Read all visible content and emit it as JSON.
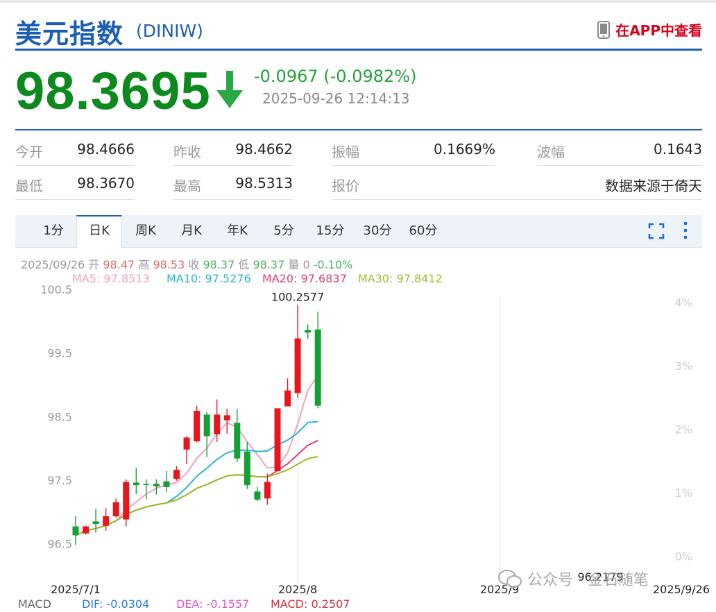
{
  "header": {
    "title": "美元指数",
    "code": "(DINIW)",
    "app_link": "在APP中查看"
  },
  "quote": {
    "price": "98.3695",
    "change": "-0.0967 (-0.0982%)",
    "time": "2025-09-26 12:14:13"
  },
  "stats": [
    {
      "label": "今开",
      "value": "98.4666"
    },
    {
      "label": "昨收",
      "value": "98.4662"
    },
    {
      "label": "振幅",
      "value": "0.1669%"
    },
    {
      "label": "波幅",
      "value": "0.1643"
    },
    {
      "label": "最低",
      "value": "98.3670"
    },
    {
      "label": "最高",
      "value": "98.5313"
    },
    {
      "label": "报价",
      "value": "数据来源于倚天"
    }
  ],
  "tabs": [
    "1分",
    "日K",
    "周K",
    "月K",
    "年K",
    "5分",
    "15分",
    "30分",
    "60分"
  ],
  "active_tab": "日K",
  "info_bar": {
    "date": "2025/09/26",
    "open_label": "开",
    "open": "98.47",
    "high_label": "高",
    "high": "98.53",
    "close_label": "收",
    "close": "98.37",
    "low_label": "低",
    "low": "98.37",
    "vol_label": "量",
    "vol": "0",
    "pct": "-0.10%"
  },
  "ma_legend": [
    {
      "text": "MA5: 97.8513",
      "color": "#f4a0bf"
    },
    {
      "text": "MA10: 97.5276",
      "color": "#29b6d1"
    },
    {
      "text": "MA20: 97.6837",
      "color": "#e23c6e"
    },
    {
      "text": "MA30: 97.8412",
      "color": "#9cbf2a"
    }
  ],
  "macd": {
    "label": "MACD",
    "dif": "DIF: -0.0304",
    "dea": "DEA: -0.1557",
    "macd": "MACD: 0.2507"
  },
  "watermark_text": "公众号 · 金石随笔",
  "colors": {
    "up": "#e8161c",
    "down": "#15a035",
    "brand": "#1b5eb3"
  },
  "chart_data": {
    "type": "candlestick",
    "ylim": [
      96.1,
      100.6
    ],
    "y_ticks": [
      "100.5",
      "99.5",
      "98.5",
      "97.5",
      "96.5"
    ],
    "y_tick_values": [
      100.5,
      99.5,
      98.5,
      97.5,
      96.5
    ],
    "pct_ticks": [
      "4%",
      "3%",
      "2%",
      "1%",
      "0%"
    ],
    "pct_tick_values": [
      100.3,
      99.3,
      98.3,
      97.3,
      96.3
    ],
    "x_tick_labels": [
      "2025/7/1",
      "2025/8",
      "2025/9",
      "2025/9/26"
    ],
    "x_tick_index": [
      0,
      22,
      42,
      60
    ],
    "annotations": [
      {
        "text": "100.2577",
        "index": 22,
        "value": 100.2577
      },
      {
        "text": "96.2179",
        "index": 52,
        "value": 96.2179
      }
    ],
    "ohlc": [
      [
        96.77,
        96.93,
        96.48,
        96.63
      ],
      [
        96.66,
        96.78,
        96.64,
        96.77
      ],
      [
        96.85,
        97.05,
        96.67,
        96.81
      ],
      [
        96.78,
        97.06,
        96.7,
        96.93
      ],
      [
        96.93,
        97.21,
        96.91,
        97.15
      ],
      [
        96.88,
        97.51,
        96.77,
        97.47
      ],
      [
        97.46,
        97.69,
        97.28,
        97.42
      ],
      [
        97.44,
        97.51,
        97.2,
        97.43
      ],
      [
        97.44,
        97.51,
        97.27,
        97.4
      ],
      [
        97.48,
        97.64,
        97.31,
        97.39
      ],
      [
        97.52,
        97.72,
        97.49,
        97.66
      ],
      [
        97.98,
        98.19,
        97.75,
        98.17
      ],
      [
        98.11,
        98.67,
        98.09,
        98.59
      ],
      [
        98.53,
        98.57,
        97.86,
        98.19
      ],
      [
        98.22,
        98.77,
        98.1,
        98.53
      ],
      [
        98.44,
        98.62,
        98.23,
        98.52
      ],
      [
        98.4,
        98.62,
        97.78,
        97.84
      ],
      [
        97.95,
        98.1,
        97.36,
        97.42
      ],
      [
        97.32,
        97.39,
        97.17,
        97.19
      ],
      [
        97.21,
        97.6,
        97.11,
        97.47
      ],
      [
        97.64,
        98.61,
        97.67,
        98.63
      ],
      [
        98.66,
        99.1,
        98.66,
        98.91
      ],
      [
        98.87,
        100.2577,
        98.79,
        99.73
      ],
      [
        99.86,
        99.95,
        99.72,
        99.82
      ],
      [
        99.87,
        100.15,
        98.63,
        98.67
      ]
    ]
  }
}
